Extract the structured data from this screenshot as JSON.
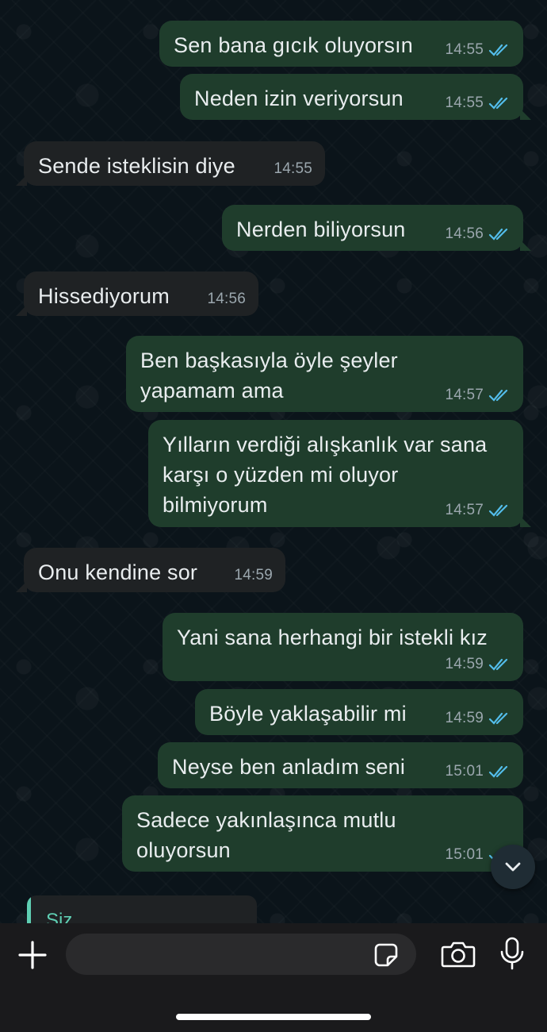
{
  "messages": [
    {
      "dir": "out",
      "text": "Sen bana gıcık oluyorsın",
      "time": "14:55",
      "read": true
    },
    {
      "dir": "out",
      "text": "Neden izin veriyorsun",
      "time": "14:55",
      "read": true
    },
    {
      "dir": "in",
      "text": "Sende isteklisin diye",
      "time": "14:55"
    },
    {
      "dir": "out",
      "text": "Nerden biliyorsun",
      "time": "14:56",
      "read": true
    },
    {
      "dir": "in",
      "text": "Hissediyorum",
      "time": "14:56"
    },
    {
      "dir": "out",
      "text": "Ben başkasıyla öyle şeyler\nyapamam ama",
      "time": "14:57",
      "read": true
    },
    {
      "dir": "out",
      "text": "Yılların verdiği alışkanlık var sana\nkarşı o yüzden mi oluyor\nbilmiyorum",
      "time": "14:57",
      "read": true
    },
    {
      "dir": "in",
      "text": "Onu kendine sor",
      "time": "14:59"
    },
    {
      "dir": "out",
      "text": "Yani sana herhangi bir istekli kız",
      "time": "14:59",
      "read": true
    },
    {
      "dir": "out",
      "text": "Böyle yaklaşabilir mi",
      "time": "14:59",
      "read": true
    },
    {
      "dir": "out",
      "text": "Neyse ben anladım seni",
      "time": "15:01",
      "read": true
    },
    {
      "dir": "out",
      "text": "Sadece yakınlaşınca mutlu\noluyorsun",
      "time": "15:01",
      "read": true
    }
  ],
  "reply_preview": {
    "sender": "Siz"
  },
  "composer": {
    "placeholder": ""
  },
  "icons": {
    "scroll_down": "chevron-down-icon",
    "attach": "plus-icon",
    "sticker": "sticker-icon",
    "camera": "camera-icon",
    "mic": "microphone-icon",
    "read_receipt": "double-check-icon"
  },
  "colors": {
    "outgoing_bubble": "#1f3d2c",
    "incoming_bubble": "#1f2224",
    "read_tick": "#53bdeb",
    "reply_accent": "#5fcfb3",
    "chat_background": "#0b141a"
  }
}
